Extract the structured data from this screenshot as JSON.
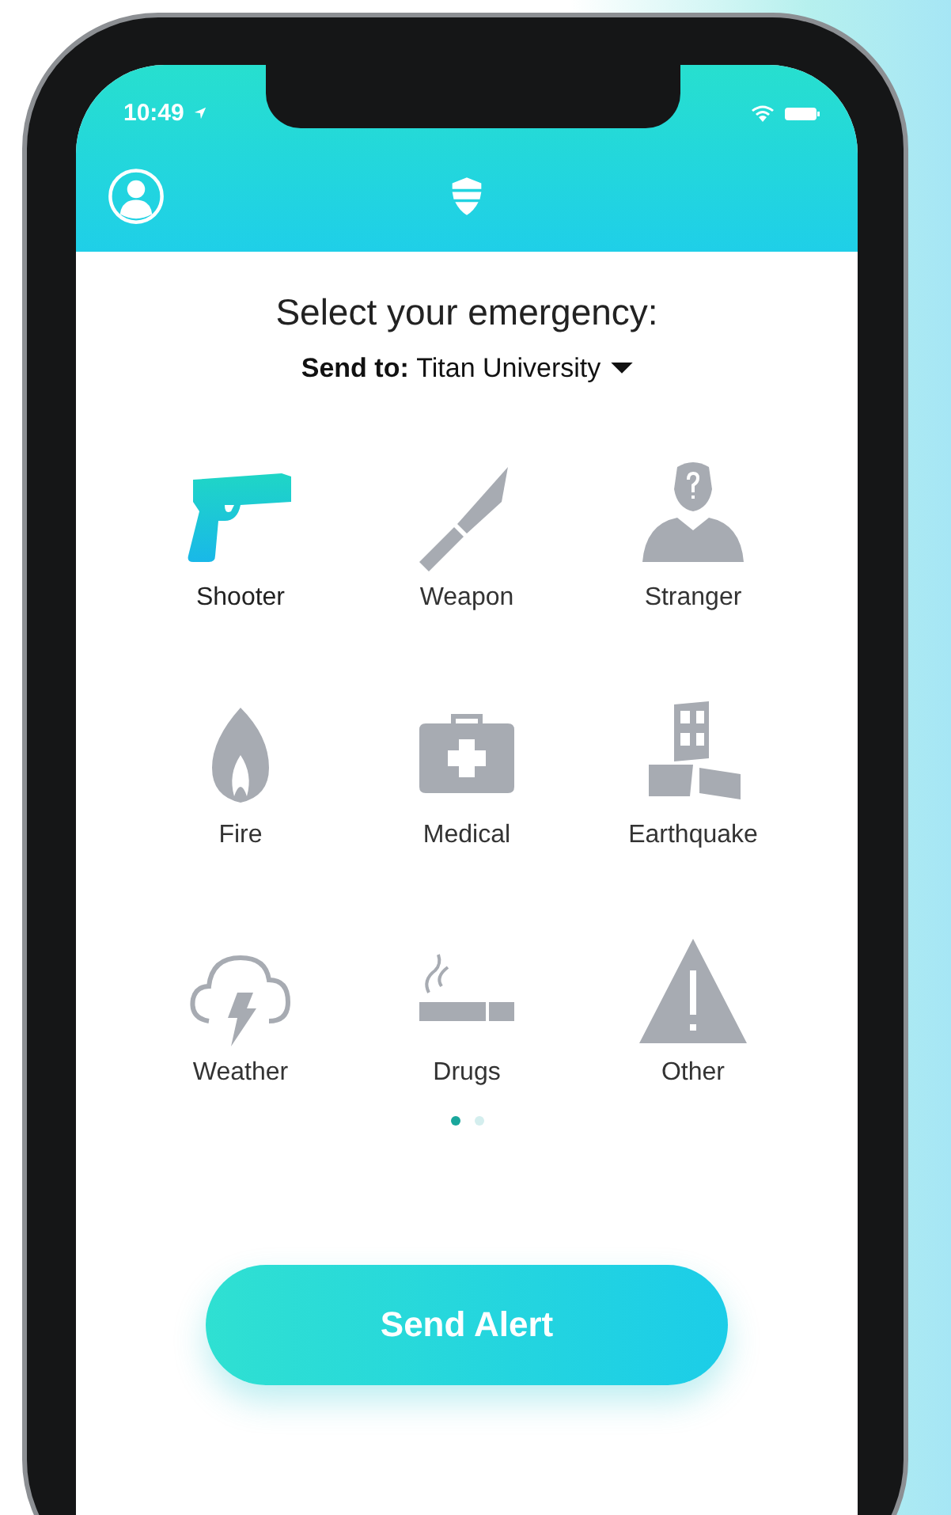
{
  "status_bar": {
    "time": "10:49"
  },
  "title": "Select your emergency:",
  "send_to": {
    "label": "Send to:",
    "value": "Titan University"
  },
  "emergencies": [
    {
      "label": "Shooter",
      "kind": "gun",
      "selected": true
    },
    {
      "label": "Weapon",
      "kind": "knife",
      "selected": false
    },
    {
      "label": "Stranger",
      "kind": "person",
      "selected": false
    },
    {
      "label": "Fire",
      "kind": "flame",
      "selected": false
    },
    {
      "label": "Medical",
      "kind": "medkit",
      "selected": false
    },
    {
      "label": "Earthquake",
      "kind": "building",
      "selected": false
    },
    {
      "label": "Weather",
      "kind": "storm",
      "selected": false
    },
    {
      "label": "Drugs",
      "kind": "cigarette",
      "selected": false
    },
    {
      "label": "Other",
      "kind": "warning",
      "selected": false
    }
  ],
  "pages": [
    {
      "selected": true
    },
    {
      "selected": false
    }
  ],
  "button": "Send Alert"
}
